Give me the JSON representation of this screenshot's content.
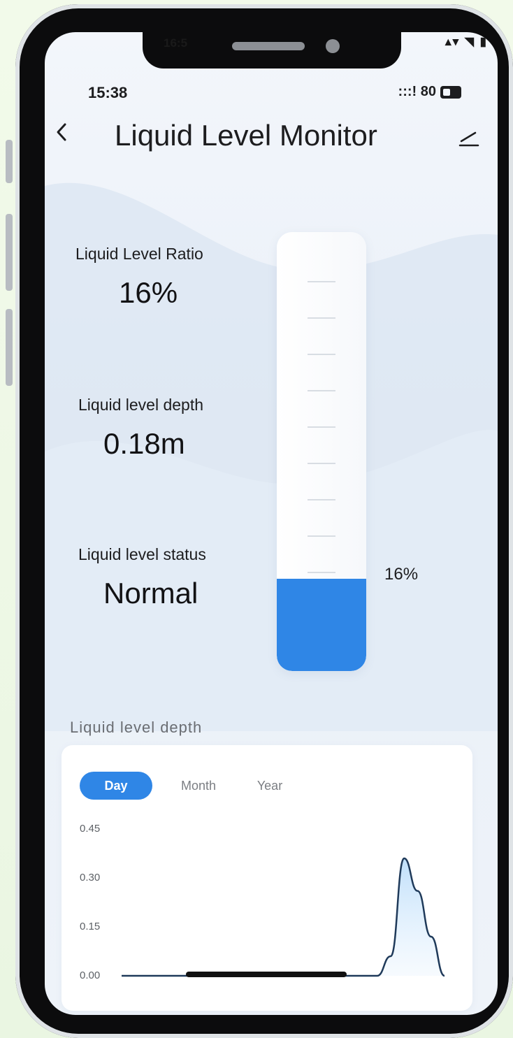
{
  "outer_status": {
    "left": "16:5",
    "right": "▴▾ ◥ ▮"
  },
  "status_bar": {
    "time": "15:38",
    "signal": ":::! 80"
  },
  "header": {
    "back_icon": "chevron-left-icon",
    "title": "Liquid Level Monitor",
    "edit_icon": "edit-icon"
  },
  "metrics": {
    "ratio": {
      "label": "Liquid Level Ratio",
      "value": "16%"
    },
    "depth": {
      "label": "Liquid level depth",
      "value": "0.18m"
    },
    "status": {
      "label": "Liquid level status",
      "value": "Normal"
    }
  },
  "tank": {
    "level_percent": 16,
    "label": "16%",
    "fill_color": "#2f86e6"
  },
  "history": {
    "section_title": "Liquid level depth",
    "tabs": [
      {
        "label": "Day",
        "active": true
      },
      {
        "label": "Month",
        "active": false
      },
      {
        "label": "Year",
        "active": false
      }
    ]
  },
  "chart_data": {
    "type": "area",
    "title": "",
    "xlabel": "",
    "ylabel": "",
    "y_ticks": [
      "0.45",
      "0.30",
      "0.15",
      "0.00"
    ],
    "ylim": [
      0,
      0.45
    ],
    "grid": false,
    "series": [
      {
        "x": [
          0,
          1,
          2,
          3,
          4,
          5,
          6,
          7,
          8,
          9,
          10,
          11,
          12,
          13,
          14,
          15,
          16,
          17,
          18,
          19,
          20,
          21,
          22,
          23,
          24
        ],
        "values": [
          0,
          0,
          0,
          0,
          0,
          0,
          0,
          0,
          0,
          0,
          0,
          0,
          0,
          0,
          0,
          0,
          0,
          0,
          0,
          0,
          0.06,
          0.36,
          0.26,
          0.12,
          0
        ]
      }
    ],
    "colors": {
      "line": "#1f3a5a",
      "fill": "#cfe6fb"
    }
  }
}
